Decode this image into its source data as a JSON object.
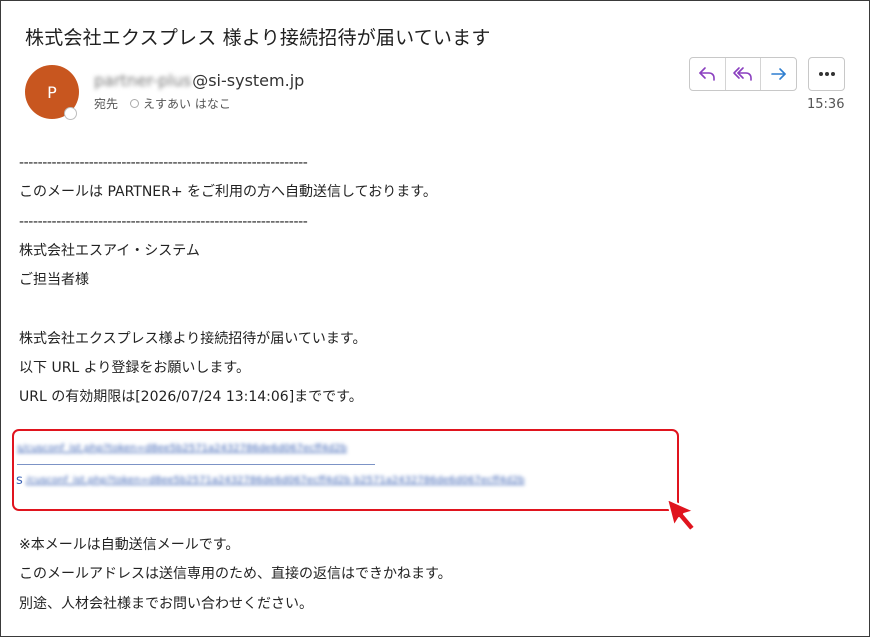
{
  "email": {
    "subject": "株式会社エクスプレス 様より接続招待が届いています",
    "avatar_initial": "P",
    "sender_name_blurred": "partner-plus",
    "sender_domain": "@si-system.jp",
    "recipient_label": "宛先",
    "recipient_name": "えすあい はなこ",
    "time": "15:36"
  },
  "actions": {
    "reply_icon": "reply-icon",
    "reply_all_icon": "reply-all-icon",
    "forward_icon": "forward-icon",
    "more_icon": "more-icon",
    "more_label": "•••"
  },
  "body": {
    "dash1": "--------------------------------------------------------------",
    "notice": "このメールは PARTNER+ をご利用の方へ自動送信しております。",
    "dash2": "--------------------------------------------------------------",
    "company": "株式会社エスアイ・システム",
    "attn": "ご担当者様",
    "invite": "株式会社エクスプレス様より接続招待が届いています。",
    "register": "以下 URL より登録をお願いします。",
    "expiry": "URL の有効期限は[2026/07/24 13:14:06]までです。"
  },
  "links": {
    "link1": "s/cusconf_ist.php?token=d8ee5b2571a2432786de6d067ecff4d2b",
    "link2_prefix": "s",
    "link2": "/cusconf_ist.php?token=d8ee5b2571a2432786de6d067ecff4d2b b2571a2432786de6d067ecff4d2b"
  },
  "footer": {
    "auto": "※本メールは自動送信メールです。",
    "sendonly": "このメールアドレスは送信専用のため、直接の返信はできかねます。",
    "contact": "別途、人材会社様までお問い合わせください。"
  },
  "colors": {
    "avatar": "#c8561f",
    "reply_purple": "#8a3fbf",
    "forward_blue": "#2f7fd0",
    "highlight_red": "#e0141e",
    "link_blue": "#3b62b5"
  }
}
